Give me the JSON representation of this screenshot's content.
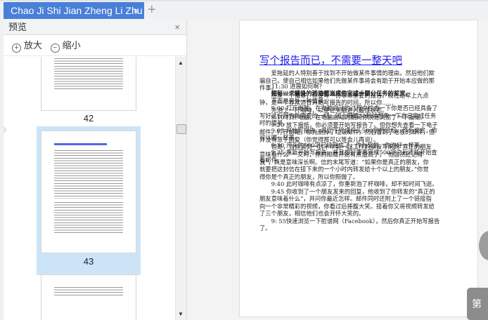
{
  "tab": {
    "title": "Chao Ji Shi Jian Zheng Li Zhu",
    "close": "×",
    "new": "+"
  },
  "sidebar": {
    "title": "预览",
    "close": "×",
    "zoom_in": "放大",
    "zoom_out": "缩小",
    "zoom_in_icon": "+",
    "zoom_out_icon": "−",
    "pages": [
      "42",
      "43"
    ]
  },
  "document": {
    "title": "写个报告而已，不需要一整天吧",
    "paragraph_lines": [
      "　　爱拖延的人特别善于找到不开始做某件事情的理由，然后他们欺",
      "骗自己，使自己相信如果他们先做某件事将会有助于开始本应做的那",
      "件事。",
      "　　想象一个情景，你要写一份非常重要的报告。现在是早上九点",
      "钟，是一个非常适合开始写报告的时间，所以你……",
      "　　先泡上一杯咖啡，以便让头脑进入最佳状态。",
      "　　9:10 打开电脑，在电脑启动的期间你快速浏览了一下报纸。",
      "　　9:20 放下报纸，你必须要开始写报告了。但你想先查看一下电子",
      "邮件。打开邮箱，你先删掉了垃圾邮件，然后看到了老板的邮件，但",
      "并没有急于回复（你觉得那可以等会儿再说）。",
      "　　但是，当你读到一封十年前一起工作的朋友写来的“真正的朋友",
      "意味着什么”一文时，你的眼睛开始有点湿润了，“他居然还记得",
      "我”，真是意味深长啊。信的末尾写道：“如果你是真正的朋友，你",
      "就要把这封信在接下来的一个小时内转发给十个以上的朋友。”你觉",
      "得你是个真正的朋友，所以你照做了。",
      "　　9:40 此时咖啡有点凉了，你重新泡了杯咖啡，却不知时间飞逝。",
      "　　9:45 你收到了一个朋友发来的回复，他收到了你转发的“真正的",
      "朋友意味着什么”，并问你最近怎样。邮件同时还附上了一个链接指",
      "向一个非常精彩的视频，你看过后捧腹大笑。接着你又将视频转发给",
      "了三个朋友，相信他们也会开怀大笑的。",
      "　　9: 55快速浏览一下脸谱网（Facebook），然后你真正开始写报告",
      "了。"
    ],
    "section2_lines": [
      "　　11:30 进展如何啊？",
      "　　你可以试着换一种方式来完成上述步骤："
    ],
    "bold_line": "　　把每一个额外的活动都当成你完成一部分任务的奖赏。",
    "section3_lines": [
      "　　下面是另外一种情景。",
      "　　9:00 打开电脑，在电脑启动的过程中检查一下你是否已经具备了",
      "写好这份报告所需要的一切。闭上眼睛30秒钟想象一下自己完成任务",
      "时的情景。",
      "　　9:03 开始写报告，并定下完成开头500字的目标，作为奖赏，你",
      "可以喝一杯茶。",
      "　　9:30 开头的500字已经完成了，作为奖赏，你泡好一杯茶。",
      "　　9:35 重新开始写报告，并且想好要再完成500字之后才能开始查",
      "看邮件。"
    ]
  },
  "page_jump_label": "第",
  "colors": {
    "tab_active": "#4a7fd8",
    "selection": "#cce4f7",
    "link": "#1a1aee"
  }
}
